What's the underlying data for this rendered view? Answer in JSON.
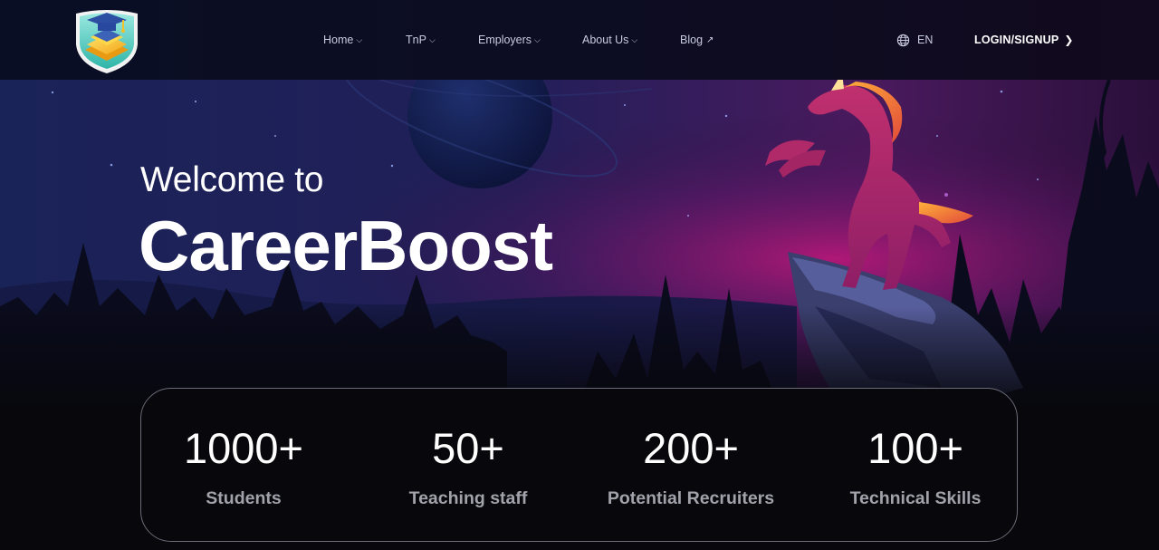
{
  "header": {
    "logo_icon": "graduation-cap-shield-logo",
    "nav": [
      {
        "label": "Home",
        "icon": "chevron-down-icon"
      },
      {
        "label": "TnP",
        "icon": "chevron-down-icon"
      },
      {
        "label": "Employers",
        "icon": "chevron-down-icon"
      },
      {
        "label": "About Us",
        "icon": "chevron-down-icon"
      },
      {
        "label": "Blog",
        "icon": "arrow-up-right-icon"
      }
    ],
    "language": {
      "label": "EN",
      "icon": "globe-icon"
    },
    "login": {
      "label": "LOGIN/SIGNUP",
      "icon": "chevron-right-icon"
    }
  },
  "hero": {
    "welcome": "Welcome to",
    "brand": "CareerBoost",
    "illustration": "unicorn-on-cliff-night-forest"
  },
  "stats": [
    {
      "value": "1000+",
      "label": "Students"
    },
    {
      "value": "50+",
      "label": "Teaching staff"
    },
    {
      "value": "200+",
      "label": "Potential Recruiters"
    },
    {
      "value": "100+",
      "label": "Technical Skills"
    }
  ],
  "colors": {
    "background": "#07070c",
    "header": "#0b0d22",
    "stat_label": "#a2a2ab",
    "accent_magenta": "#c2187a",
    "accent_blue": "#1b2a6b"
  }
}
